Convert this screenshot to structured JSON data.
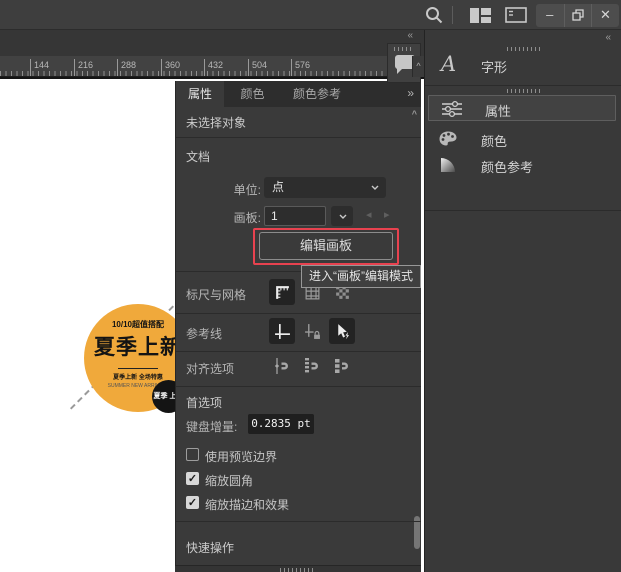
{
  "colors": {
    "red": "#E8424F",
    "yellow": "#F0A93B"
  },
  "icons": {
    "check": "✓",
    "collapse": "«",
    "panel_menu": "»",
    "scroll_up": "^",
    "prev": "◂",
    "next": "▸",
    "minimize": "–",
    "close": "✕"
  },
  "ruler": {
    "numbers": [
      "144",
      "216",
      "288",
      "360",
      "432",
      "504",
      "576"
    ]
  },
  "artwork": {
    "top_line": "10/10超值搭配",
    "title": "夏季上新",
    "sub_line": "夏季上新 全场特惠",
    "tiny_line": "SUMMER NEW ARRIVALS",
    "badge": "夏季 上新"
  },
  "panel": {
    "tabs": [
      {
        "label": "属性"
      },
      {
        "label": "颜色"
      },
      {
        "label": "颜色参考"
      }
    ],
    "no_selection": "未选择对象",
    "document": {
      "header": "文档",
      "unit_label": "单位:",
      "unit_value": "点",
      "artboard_label": "画板:",
      "artboard_value": "1",
      "edit_button": "编辑画板",
      "tooltip": "进入“画板”编辑模式"
    },
    "sections": {
      "rulers_grids": "标尺与网格",
      "guides": "参考线",
      "snap_options": "对齐选项",
      "preferences": "首选项",
      "quick_actions": "快速操作"
    },
    "keyboard_label": "键盘增量:",
    "keyboard_value": "0.2835 pt",
    "checkboxes": [
      {
        "label": "使用预览边界",
        "checked": false
      },
      {
        "label": "缩放圆角",
        "checked": true
      },
      {
        "label": "缩放描边和效果",
        "checked": true
      }
    ]
  },
  "sidebar": {
    "glyphs_label": "字形",
    "items": [
      {
        "label": "属性",
        "selected": true
      },
      {
        "label": "颜色",
        "selected": false
      },
      {
        "label": "颜色参考",
        "selected": false
      }
    ]
  }
}
